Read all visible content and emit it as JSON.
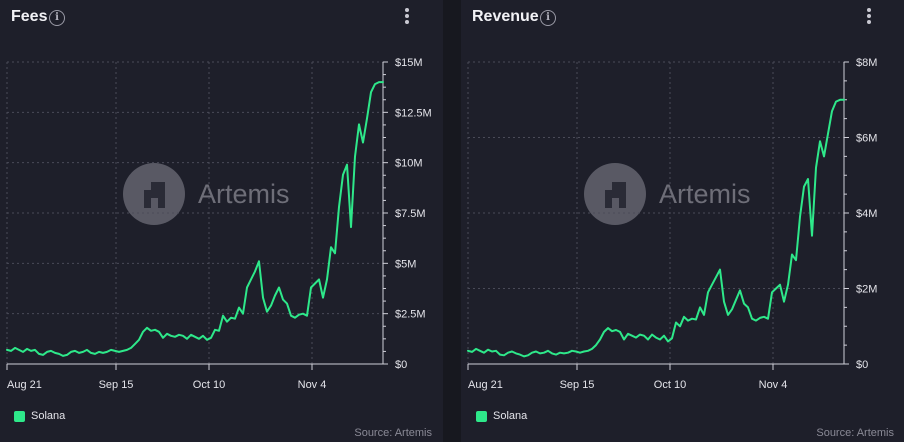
{
  "colors": {
    "line": "#2ee88a",
    "grid": "#4a4b58",
    "axis": "#cfcfd8",
    "watermark": "#6e6e78"
  },
  "icons": {
    "info": "info-icon",
    "menu": "kebab-menu-icon",
    "watermark_logo": "artemis-logo-icon"
  },
  "watermark": "Artemis",
  "panels": [
    {
      "title": "Fees",
      "legend": "Solana",
      "source": "Source: Artemis"
    },
    {
      "title": "Revenue",
      "legend": "Solana",
      "source": "Source: Artemis"
    }
  ],
  "chart_data": [
    {
      "type": "line",
      "title": "Fees",
      "x_tick_labels": [
        "Aug 21",
        "Sep 15",
        "Oct 10",
        "Nov 4"
      ],
      "y_tick_labels": [
        "$0",
        "$2.5M",
        "$5M",
        "$7.5M",
        "$10M",
        "$12.5M",
        "$15M"
      ],
      "ylim": [
        0,
        15000000
      ],
      "x_range": [
        "2024-08-21",
        "2024-11-23"
      ],
      "grid": true,
      "legend_position": "bottom-left",
      "series": [
        {
          "name": "Solana",
          "x": [
            "2024-08-21",
            "2024-08-22",
            "2024-08-23",
            "2024-08-24",
            "2024-08-25",
            "2024-08-26",
            "2024-08-27",
            "2024-08-28",
            "2024-08-29",
            "2024-08-30",
            "2024-08-31",
            "2024-09-01",
            "2024-09-02",
            "2024-09-03",
            "2024-09-04",
            "2024-09-05",
            "2024-09-06",
            "2024-09-07",
            "2024-09-08",
            "2024-09-09",
            "2024-09-10",
            "2024-09-11",
            "2024-09-12",
            "2024-09-13",
            "2024-09-14",
            "2024-09-15",
            "2024-09-16",
            "2024-09-17",
            "2024-09-18",
            "2024-09-19",
            "2024-09-20",
            "2024-09-21",
            "2024-09-22",
            "2024-09-23",
            "2024-09-24",
            "2024-09-25",
            "2024-09-26",
            "2024-09-27",
            "2024-09-28",
            "2024-09-29",
            "2024-09-30",
            "2024-10-01",
            "2024-10-02",
            "2024-10-03",
            "2024-10-04",
            "2024-10-05",
            "2024-10-06",
            "2024-10-07",
            "2024-10-08",
            "2024-10-09",
            "2024-10-10",
            "2024-10-11",
            "2024-10-12",
            "2024-10-13",
            "2024-10-14",
            "2024-10-15",
            "2024-10-16",
            "2024-10-17",
            "2024-10-18",
            "2024-10-19",
            "2024-10-20",
            "2024-10-21",
            "2024-10-22",
            "2024-10-23",
            "2024-10-24",
            "2024-10-25",
            "2024-10-26",
            "2024-10-27",
            "2024-10-28",
            "2024-10-29",
            "2024-10-30",
            "2024-10-31",
            "2024-11-01",
            "2024-11-02",
            "2024-11-03",
            "2024-11-04",
            "2024-11-05",
            "2024-11-06",
            "2024-11-07",
            "2024-11-08",
            "2024-11-09",
            "2024-11-10",
            "2024-11-11",
            "2024-11-12",
            "2024-11-13",
            "2024-11-14",
            "2024-11-15",
            "2024-11-16",
            "2024-11-17",
            "2024-11-18",
            "2024-11-19",
            "2024-11-20",
            "2024-11-21",
            "2024-11-22",
            "2024-11-23"
          ],
          "values": [
            700000,
            650000,
            800000,
            700000,
            600000,
            750000,
            650000,
            700000,
            500000,
            450000,
            600000,
            650000,
            550000,
            500000,
            400000,
            450000,
            600000,
            650000,
            550000,
            600000,
            700000,
            550000,
            500000,
            600000,
            550000,
            600000,
            700000,
            650000,
            600000,
            650000,
            700000,
            800000,
            1000000,
            1200000,
            1600000,
            1800000,
            1650000,
            1700000,
            1600000,
            1300000,
            1500000,
            1400000,
            1350000,
            1450000,
            1400000,
            1250000,
            1450000,
            1350000,
            1250000,
            1400000,
            1200000,
            1300000,
            1700000,
            1650000,
            2400000,
            2100000,
            2300000,
            2250000,
            2800000,
            2500000,
            3800000,
            4200000,
            4600000,
            5100000,
            3300000,
            2600000,
            2900000,
            3400000,
            3800000,
            3200000,
            3000000,
            2400000,
            2300000,
            2450000,
            2500000,
            2400000,
            3800000,
            4000000,
            4200000,
            3300000,
            4200000,
            5800000,
            5500000,
            7800000,
            9400000,
            9900000,
            6800000,
            10300000,
            11900000,
            11000000,
            12200000,
            13500000,
            13900000,
            14000000,
            14000000
          ]
        }
      ]
    },
    {
      "type": "line",
      "title": "Revenue",
      "x_tick_labels": [
        "Aug 21",
        "Sep 15",
        "Oct 10",
        "Nov 4"
      ],
      "y_tick_labels": [
        "$0",
        "$2M",
        "$4M",
        "$6M",
        "$8M"
      ],
      "ylim": [
        0,
        8000000
      ],
      "x_range": [
        "2024-08-21",
        "2024-11-23"
      ],
      "grid": true,
      "legend_position": "bottom-left",
      "series": [
        {
          "name": "Solana",
          "x": [
            "2024-08-21",
            "2024-08-22",
            "2024-08-23",
            "2024-08-24",
            "2024-08-25",
            "2024-08-26",
            "2024-08-27",
            "2024-08-28",
            "2024-08-29",
            "2024-08-30",
            "2024-08-31",
            "2024-09-01",
            "2024-09-02",
            "2024-09-03",
            "2024-09-04",
            "2024-09-05",
            "2024-09-06",
            "2024-09-07",
            "2024-09-08",
            "2024-09-09",
            "2024-09-10",
            "2024-09-11",
            "2024-09-12",
            "2024-09-13",
            "2024-09-14",
            "2024-09-15",
            "2024-09-16",
            "2024-09-17",
            "2024-09-18",
            "2024-09-19",
            "2024-09-20",
            "2024-09-21",
            "2024-09-22",
            "2024-09-23",
            "2024-09-24",
            "2024-09-25",
            "2024-09-26",
            "2024-09-27",
            "2024-09-28",
            "2024-09-29",
            "2024-09-30",
            "2024-10-01",
            "2024-10-02",
            "2024-10-03",
            "2024-10-04",
            "2024-10-05",
            "2024-10-06",
            "2024-10-07",
            "2024-10-08",
            "2024-10-09",
            "2024-10-10",
            "2024-10-11",
            "2024-10-12",
            "2024-10-13",
            "2024-10-14",
            "2024-10-15",
            "2024-10-16",
            "2024-10-17",
            "2024-10-18",
            "2024-10-19",
            "2024-10-20",
            "2024-10-21",
            "2024-10-22",
            "2024-10-23",
            "2024-10-24",
            "2024-10-25",
            "2024-10-26",
            "2024-10-27",
            "2024-10-28",
            "2024-10-29",
            "2024-10-30",
            "2024-10-31",
            "2024-11-01",
            "2024-11-02",
            "2024-11-03",
            "2024-11-04",
            "2024-11-05",
            "2024-11-06",
            "2024-11-07",
            "2024-11-08",
            "2024-11-09",
            "2024-11-10",
            "2024-11-11",
            "2024-11-12",
            "2024-11-13",
            "2024-11-14",
            "2024-11-15",
            "2024-11-16",
            "2024-11-17",
            "2024-11-18",
            "2024-11-19",
            "2024-11-20",
            "2024-11-21",
            "2024-11-22",
            "2024-11-23"
          ],
          "values": [
            350000,
            320000,
            400000,
            350000,
            300000,
            380000,
            330000,
            350000,
            250000,
            230000,
            300000,
            330000,
            280000,
            250000,
            200000,
            230000,
            300000,
            330000,
            280000,
            300000,
            350000,
            280000,
            250000,
            300000,
            280000,
            300000,
            350000,
            330000,
            300000,
            330000,
            350000,
            400000,
            500000,
            650000,
            850000,
            950000,
            870000,
            900000,
            850000,
            650000,
            800000,
            750000,
            700000,
            780000,
            750000,
            650000,
            780000,
            700000,
            650000,
            750000,
            600000,
            680000,
            1100000,
            1000000,
            1250000,
            1150000,
            1200000,
            1180000,
            1500000,
            1300000,
            1900000,
            2100000,
            2300000,
            2500000,
            1650000,
            1300000,
            1450000,
            1700000,
            1950000,
            1600000,
            1500000,
            1200000,
            1150000,
            1220000,
            1250000,
            1200000,
            1900000,
            2000000,
            2100000,
            1650000,
            2100000,
            2900000,
            2750000,
            3900000,
            4700000,
            4900000,
            3400000,
            5200000,
            5900000,
            5500000,
            6100000,
            6700000,
            6950000,
            7000000,
            7000000
          ]
        }
      ]
    }
  ]
}
